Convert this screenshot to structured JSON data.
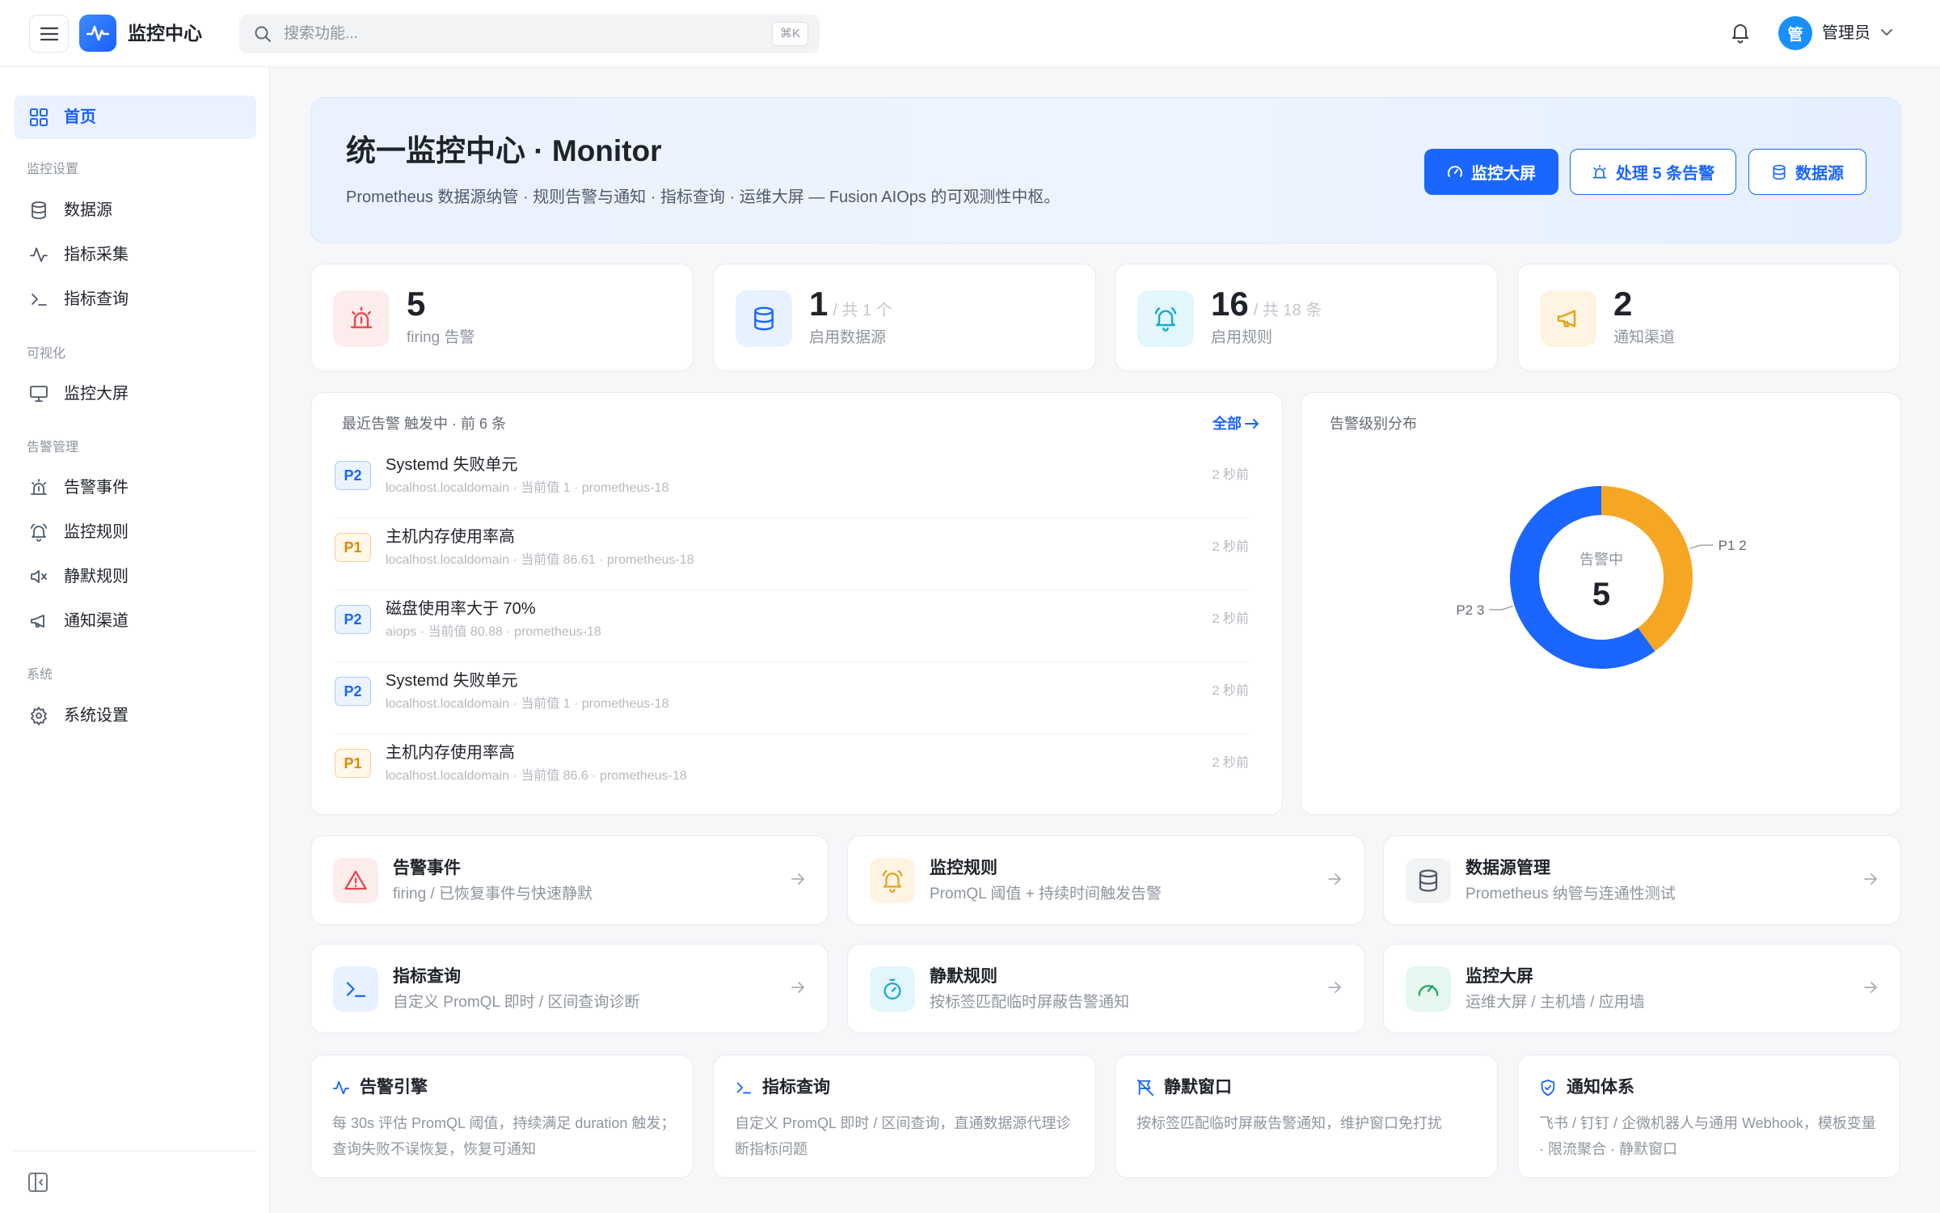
{
  "header": {
    "brand": "监控中心",
    "search_placeholder": "搜索功能...",
    "search_shortcut": "⌘K",
    "user_avatar": "管",
    "user_name": "管理员"
  },
  "sidebar": {
    "home": "首页",
    "groups": [
      {
        "label": "监控设置",
        "items": [
          "数据源",
          "指标采集",
          "指标查询"
        ]
      },
      {
        "label": "可视化",
        "items": [
          "监控大屏"
        ]
      },
      {
        "label": "告警管理",
        "items": [
          "告警事件",
          "监控规则",
          "静默规则",
          "通知渠道"
        ]
      },
      {
        "label": "系统",
        "items": [
          "系统设置"
        ]
      }
    ]
  },
  "hero": {
    "title": "统一监控中心 · Monitor",
    "subtitle": "Prometheus 数据源纳管 · 规则告警与通知 · 指标查询 · 运维大屏 — Fusion AIOps 的可观测性中枢。",
    "btn_dashboard": "监控大屏",
    "btn_alerts": "处理 5 条告警",
    "btn_datasource": "数据源"
  },
  "stats": [
    {
      "value": "5",
      "suffix": "",
      "label": "firing 告警"
    },
    {
      "value": "1",
      "suffix": "/ 共 1 个",
      "label": "启用数据源"
    },
    {
      "value": "16",
      "suffix": "/ 共 18 条",
      "label": "启用规则"
    },
    {
      "value": "2",
      "suffix": "",
      "label": "通知渠道"
    }
  ],
  "alerts_panel": {
    "title": "最近告警   触发中 · 前 6 条",
    "more": "全部",
    "rows": [
      {
        "sev": "P2",
        "name": "Systemd 失败单元",
        "meta": "localhost.localdomain · 当前值 1 · prometheus-18",
        "time": "2 秒前"
      },
      {
        "sev": "P1",
        "name": "主机内存使用率高",
        "meta": "localhost.localdomain · 当前值 86.61 · prometheus-18",
        "time": "2 秒前"
      },
      {
        "sev": "P2",
        "name": "磁盘使用率大于 70%",
        "meta": "aiops · 当前值 80.88 · prometheus-18",
        "time": "2 秒前"
      },
      {
        "sev": "P2",
        "name": "Systemd 失败单元",
        "meta": "localhost.localdomain · 当前值 1 · prometheus-18",
        "time": "2 秒前"
      },
      {
        "sev": "P1",
        "name": "主机内存使用率高",
        "meta": "localhost.localdomain · 当前值 86.6 · prometheus-18",
        "time": "2 秒前"
      }
    ]
  },
  "chart_data": {
    "type": "pie",
    "title": "告警级别分布",
    "center_label": "告警中",
    "center_value": "5",
    "categories": [
      "P1",
      "P2"
    ],
    "values": [
      2,
      3
    ],
    "colors": [
      "#f5a623",
      "#1a66ff"
    ],
    "slice_labels": [
      "P1 2",
      "P2 3"
    ]
  },
  "quick_links": [
    {
      "title": "告警事件",
      "desc": "firing / 已恢复事件与快速静默"
    },
    {
      "title": "监控规则",
      "desc": "PromQL 阈值 + 持续时间触发告警"
    },
    {
      "title": "数据源管理",
      "desc": "Prometheus 纳管与连通性测试"
    },
    {
      "title": "指标查询",
      "desc": "自定义 PromQL 即时 / 区间查询诊断"
    },
    {
      "title": "静默规则",
      "desc": "按标签匹配临时屏蔽告警通知"
    },
    {
      "title": "监控大屏",
      "desc": "运维大屏 / 主机墙 / 应用墙"
    }
  ],
  "features": [
    {
      "title": "告警引擎",
      "desc": "每 30s 评估 PromQL 阈值，持续满足 duration 触发；查询失败不误恢复，恢复可通知"
    },
    {
      "title": "指标查询",
      "desc": "自定义 PromQL 即时 / 区间查询，直通数据源代理诊断指标问题"
    },
    {
      "title": "静默窗口",
      "desc": "按标签匹配临时屏蔽告警通知，维护窗口免打扰"
    },
    {
      "title": "通知体系",
      "desc": "飞书 / 钉钉 / 企微机器人与通用 Webhook，模板变量 · 限流聚合 · 静默窗口"
    }
  ]
}
